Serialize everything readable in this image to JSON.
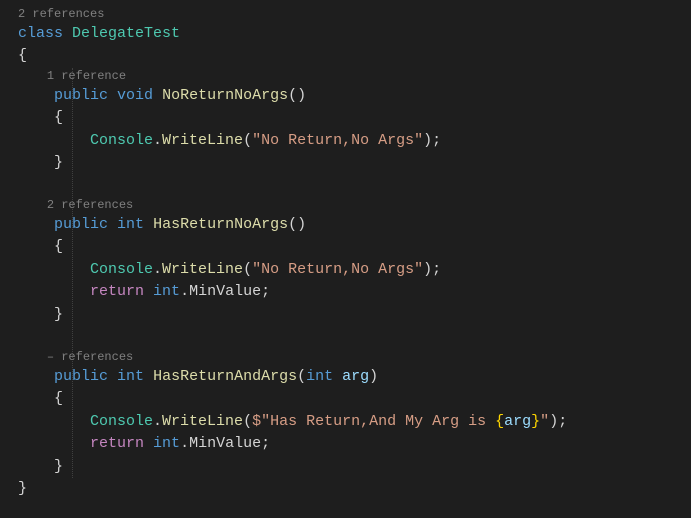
{
  "class": {
    "codelens": "2 references",
    "keyword": "class",
    "name": "DelegateTest"
  },
  "methods": [
    {
      "codelens": "1 reference",
      "access": "public",
      "returnType": "void",
      "name": "NoReturnNoArgs",
      "params": "",
      "body": {
        "consoleType": "Console",
        "dot": ".",
        "writeMethod": "WriteLine",
        "stringLiteral": "\"No Return,No Args\"",
        "hasReturn": false
      }
    },
    {
      "codelens": "2 references",
      "access": "public",
      "returnType": "int",
      "name": "HasReturnNoArgs",
      "params": "",
      "body": {
        "consoleType": "Console",
        "dot": ".",
        "writeMethod": "WriteLine",
        "stringLiteral": "\"No Return,No Args\"",
        "hasReturn": true,
        "returnKw": "return",
        "returnTypeRef": "int",
        "returnMember": "MinValue"
      }
    },
    {
      "codelens": "– references",
      "access": "public",
      "returnType": "int",
      "name": "HasReturnAndArgs",
      "paramType": "int",
      "paramName": "arg",
      "body": {
        "consoleType": "Console",
        "dot": ".",
        "writeMethod": "WriteLine",
        "interpPrefix": "$\"Has Return,And My Arg is ",
        "interpVarName": "arg",
        "interpSuffix": "\"",
        "hasReturn": true,
        "returnKw": "return",
        "returnTypeRef": "int",
        "returnMember": "MinValue"
      }
    }
  ]
}
